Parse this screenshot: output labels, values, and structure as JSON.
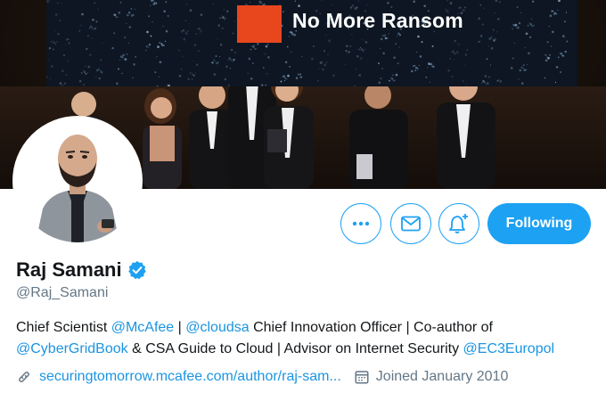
{
  "banner": {
    "logo_text": "No More Ransom",
    "colors": {
      "logo_square": "#e8461d",
      "screen_bg": "#0d1622"
    }
  },
  "actions": {
    "more_icon": "more-dots-icon",
    "message_icon": "envelope-icon",
    "notify_icon": "bell-plus-icon",
    "follow_label": "Following"
  },
  "profile": {
    "name": "Raj Samani",
    "verified": true,
    "handle": "@Raj_Samani",
    "bio": {
      "t1": "Chief Scientist ",
      "link_mcafee": "@McAfee",
      "t2": " | ",
      "link_cloudsa": "@cloudsa",
      "t3": " Chief Innovation Officer | Co-author of ",
      "link_cybergridbook": "@CyberGridBook",
      "t4": " & CSA Guide to Cloud | Advisor on Internet Security ",
      "link_ec3": "@EC3Europol"
    },
    "website": "securingtomorrow.mcafee.com/author/raj-sam...",
    "joined": "Joined January 2010"
  },
  "colors": {
    "accent": "#1da1f2",
    "link": "#1b95e0",
    "muted": "#657786",
    "text": "#14171a"
  }
}
